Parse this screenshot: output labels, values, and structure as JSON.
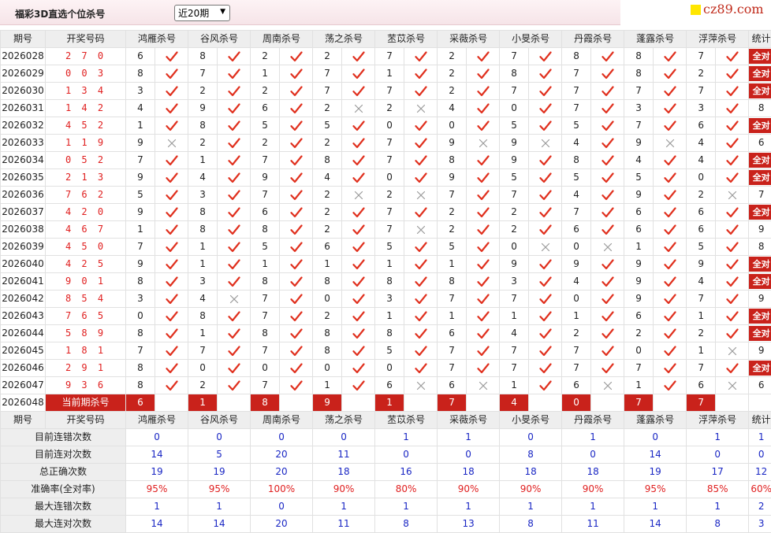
{
  "header": {
    "title": "福彩3D直选个位杀号",
    "period_select": "近20期",
    "logo_text": "cz89.com"
  },
  "columns": {
    "period": "期号",
    "draw": "开奖号码",
    "experts": [
      "鸿雁杀号",
      "谷风杀号",
      "周南杀号",
      "荡之杀号",
      "苤苡杀号",
      "采薇杀号",
      "小旻杀号",
      "丹霞杀号",
      "蓬露杀号",
      "浮萍杀号"
    ],
    "stats": "统计"
  },
  "labels": {
    "all_right": "全对",
    "current": "当前期杀号"
  },
  "rows": [
    {
      "period": "2026028",
      "draw": "270",
      "kills": [
        6,
        8,
        2,
        2,
        7,
        2,
        7,
        8,
        8,
        7
      ],
      "hits": [
        1,
        1,
        1,
        1,
        1,
        1,
        1,
        1,
        1,
        1
      ],
      "stat": "全对"
    },
    {
      "period": "2026029",
      "draw": "003",
      "kills": [
        8,
        7,
        1,
        7,
        1,
        2,
        8,
        7,
        8,
        2
      ],
      "hits": [
        1,
        1,
        1,
        1,
        1,
        1,
        1,
        1,
        1,
        1
      ],
      "stat": "全对"
    },
    {
      "period": "2026030",
      "draw": "134",
      "kills": [
        3,
        2,
        2,
        7,
        7,
        2,
        7,
        7,
        7,
        7
      ],
      "hits": [
        1,
        1,
        1,
        1,
        1,
        1,
        1,
        1,
        1,
        1
      ],
      "stat": "全对"
    },
    {
      "period": "2026031",
      "draw": "142",
      "kills": [
        4,
        9,
        6,
        2,
        2,
        4,
        0,
        7,
        3,
        3
      ],
      "hits": [
        1,
        1,
        1,
        0,
        0,
        1,
        1,
        1,
        1,
        1
      ],
      "stat": "8"
    },
    {
      "period": "2026032",
      "draw": "452",
      "kills": [
        1,
        8,
        5,
        5,
        0,
        0,
        5,
        5,
        7,
        6
      ],
      "hits": [
        1,
        1,
        1,
        1,
        1,
        1,
        1,
        1,
        1,
        1
      ],
      "stat": "全对"
    },
    {
      "period": "2026033",
      "draw": "119",
      "kills": [
        9,
        2,
        2,
        2,
        7,
        9,
        9,
        4,
        9,
        4
      ],
      "hits": [
        0,
        1,
        1,
        1,
        1,
        0,
        0,
        1,
        0,
        1
      ],
      "stat": "6"
    },
    {
      "period": "2026034",
      "draw": "052",
      "kills": [
        7,
        1,
        7,
        8,
        7,
        8,
        9,
        8,
        4,
        4
      ],
      "hits": [
        1,
        1,
        1,
        1,
        1,
        1,
        1,
        1,
        1,
        1
      ],
      "stat": "全对"
    },
    {
      "period": "2026035",
      "draw": "213",
      "kills": [
        9,
        4,
        9,
        4,
        0,
        9,
        5,
        5,
        5,
        0
      ],
      "hits": [
        1,
        1,
        1,
        1,
        1,
        1,
        1,
        1,
        1,
        1
      ],
      "stat": "全对"
    },
    {
      "period": "2026036",
      "draw": "762",
      "kills": [
        5,
        3,
        7,
        2,
        2,
        7,
        7,
        4,
        9,
        2
      ],
      "hits": [
        1,
        1,
        1,
        0,
        0,
        1,
        1,
        1,
        1,
        0
      ],
      "stat": "7"
    },
    {
      "period": "2026037",
      "draw": "420",
      "kills": [
        9,
        8,
        6,
        2,
        7,
        2,
        2,
        7,
        6,
        6
      ],
      "hits": [
        1,
        1,
        1,
        1,
        1,
        1,
        1,
        1,
        1,
        1
      ],
      "stat": "全对"
    },
    {
      "period": "2026038",
      "draw": "467",
      "kills": [
        1,
        8,
        8,
        2,
        7,
        2,
        2,
        6,
        6,
        6
      ],
      "hits": [
        1,
        1,
        1,
        1,
        0,
        1,
        1,
        1,
        1,
        1
      ],
      "stat": "9"
    },
    {
      "period": "2026039",
      "draw": "450",
      "kills": [
        7,
        1,
        5,
        6,
        5,
        5,
        0,
        0,
        1,
        5
      ],
      "hits": [
        1,
        1,
        1,
        1,
        1,
        1,
        0,
        0,
        1,
        1
      ],
      "stat": "8"
    },
    {
      "period": "2026040",
      "draw": "425",
      "kills": [
        9,
        1,
        1,
        1,
        1,
        1,
        9,
        9,
        9,
        9
      ],
      "hits": [
        1,
        1,
        1,
        1,
        1,
        1,
        1,
        1,
        1,
        1
      ],
      "stat": "全对"
    },
    {
      "period": "2026041",
      "draw": "901",
      "kills": [
        8,
        3,
        8,
        8,
        8,
        8,
        3,
        4,
        9,
        4
      ],
      "hits": [
        1,
        1,
        1,
        1,
        1,
        1,
        1,
        1,
        1,
        1
      ],
      "stat": "全对"
    },
    {
      "period": "2026042",
      "draw": "854",
      "kills": [
        3,
        4,
        7,
        0,
        3,
        7,
        7,
        0,
        9,
        7
      ],
      "hits": [
        1,
        0,
        1,
        1,
        1,
        1,
        1,
        1,
        1,
        1
      ],
      "stat": "9"
    },
    {
      "period": "2026043",
      "draw": "765",
      "kills": [
        0,
        8,
        7,
        2,
        1,
        1,
        1,
        1,
        6,
        1
      ],
      "hits": [
        1,
        1,
        1,
        1,
        1,
        1,
        1,
        1,
        1,
        1
      ],
      "stat": "全对"
    },
    {
      "period": "2026044",
      "draw": "589",
      "kills": [
        8,
        1,
        8,
        8,
        8,
        6,
        4,
        2,
        2,
        2
      ],
      "hits": [
        1,
        1,
        1,
        1,
        1,
        1,
        1,
        1,
        1,
        1
      ],
      "stat": "全对"
    },
    {
      "period": "2026045",
      "draw": "181",
      "kills": [
        7,
        7,
        7,
        8,
        5,
        7,
        7,
        7,
        0,
        1
      ],
      "hits": [
        1,
        1,
        1,
        1,
        1,
        1,
        1,
        1,
        1,
        0
      ],
      "stat": "9"
    },
    {
      "period": "2026046",
      "draw": "291",
      "kills": [
        8,
        0,
        0,
        0,
        0,
        7,
        7,
        7,
        7,
        7
      ],
      "hits": [
        1,
        1,
        1,
        1,
        1,
        1,
        1,
        1,
        1,
        1
      ],
      "stat": "全对"
    },
    {
      "period": "2026047",
      "draw": "936",
      "kills": [
        8,
        2,
        7,
        1,
        6,
        6,
        1,
        6,
        1,
        6
      ],
      "hits": [
        1,
        1,
        1,
        1,
        0,
        0,
        1,
        0,
        1,
        0
      ],
      "stat": "6"
    }
  ],
  "current": {
    "period": "2026048",
    "kills": [
      "6",
      "1",
      "8",
      "9",
      "1",
      "7",
      "4",
      "0",
      "7",
      "7"
    ]
  },
  "summary": [
    {
      "label": "目前连错次数",
      "values": [
        "0",
        "0",
        "0",
        "0",
        "1",
        "1",
        "0",
        "1",
        "0",
        "1"
      ],
      "stat": "1",
      "color": "blue"
    },
    {
      "label": "目前连对次数",
      "values": [
        "14",
        "5",
        "20",
        "11",
        "0",
        "0",
        "8",
        "0",
        "14",
        "0"
      ],
      "stat": "0",
      "color": "blue"
    },
    {
      "label": "总正确次数",
      "values": [
        "19",
        "19",
        "20",
        "18",
        "16",
        "18",
        "18",
        "18",
        "19",
        "17"
      ],
      "stat": "12",
      "color": "blue"
    },
    {
      "label": "准确率(全对率)",
      "values": [
        "95%",
        "95%",
        "100%",
        "90%",
        "80%",
        "90%",
        "90%",
        "90%",
        "95%",
        "85%"
      ],
      "stat": "60%",
      "color": "red"
    },
    {
      "label": "最大连错次数",
      "values": [
        "1",
        "1",
        "0",
        "1",
        "1",
        "1",
        "1",
        "1",
        "1",
        "1"
      ],
      "stat": "2",
      "color": "blue"
    },
    {
      "label": "最大连对次数",
      "values": [
        "14",
        "14",
        "20",
        "11",
        "8",
        "13",
        "8",
        "11",
        "14",
        "8"
      ],
      "stat": "3",
      "color": "blue"
    }
  ],
  "colors": {
    "accent_red": "#c9221b",
    "number_red": "#e02020",
    "stat_blue": "#1a27c4",
    "header_gray": "#eeeeee"
  }
}
